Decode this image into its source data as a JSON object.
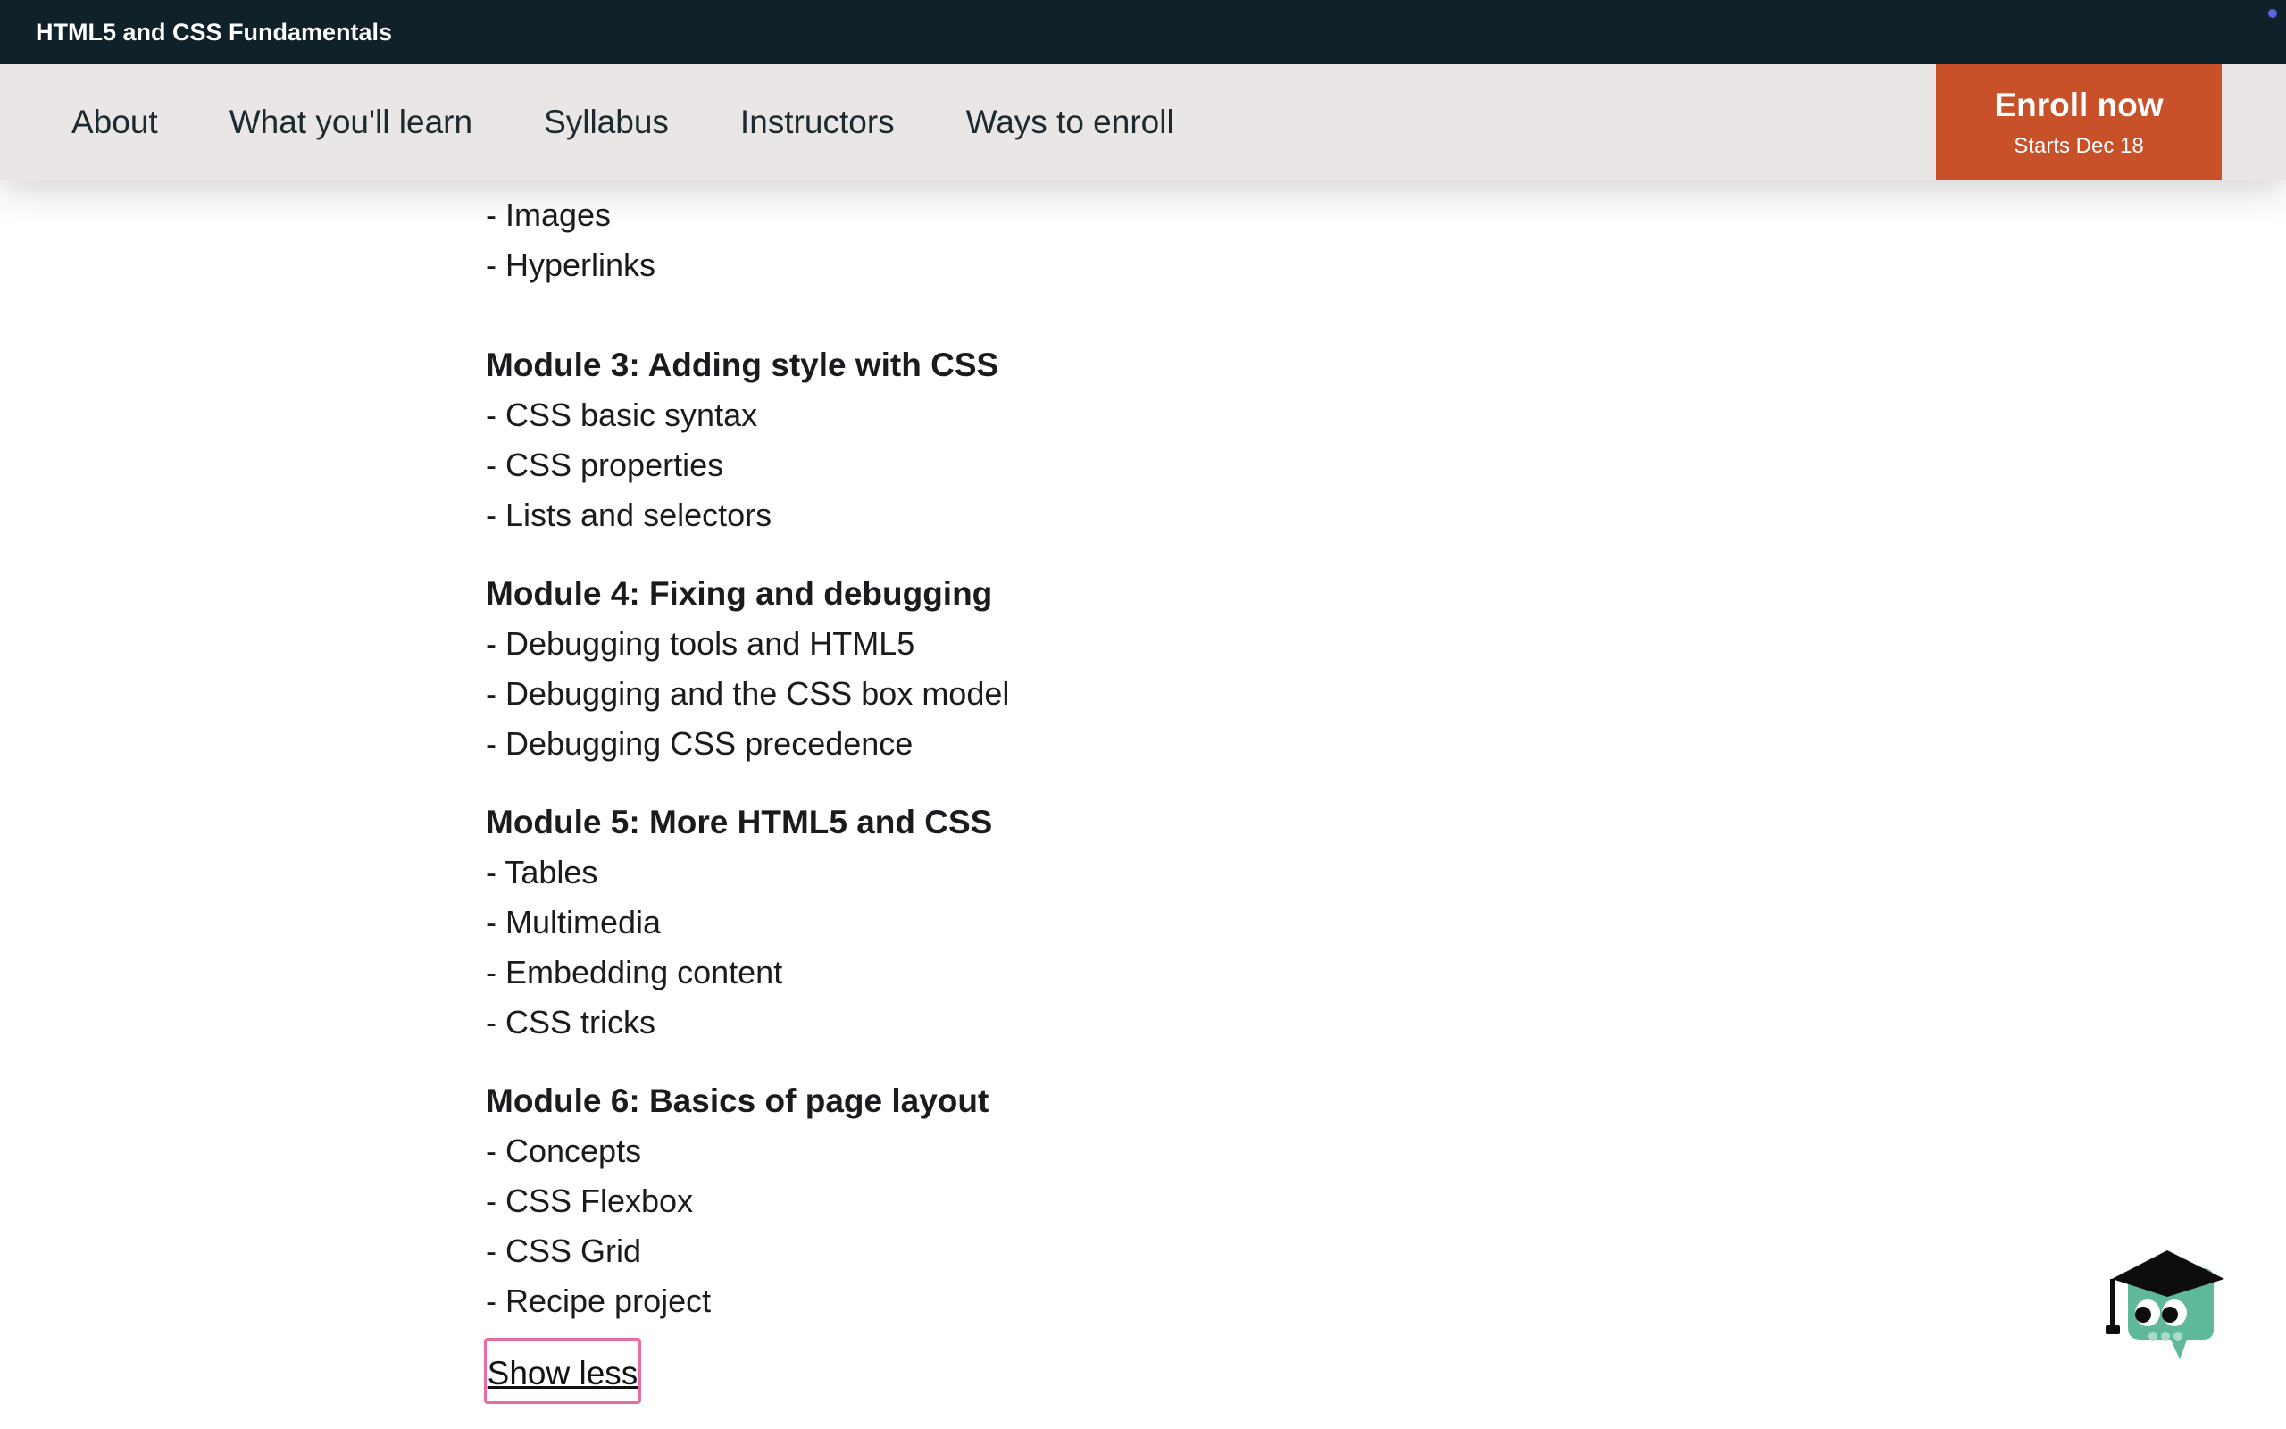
{
  "header": {
    "course_title": "HTML5 and CSS Fundamentals"
  },
  "nav": {
    "links": [
      "About",
      "What you'll learn",
      "Syllabus",
      "Instructors",
      "Ways to enroll"
    ],
    "enroll": {
      "label": "Enroll now",
      "sub": "Starts Dec 18"
    }
  },
  "syllabus": {
    "module2_tail": [
      "- Images",
      "- Hyperlinks"
    ],
    "module3": {
      "title": "Module 3: Adding style with CSS",
      "items": [
        "- CSS basic syntax",
        "- CSS properties",
        "- Lists and selectors"
      ]
    },
    "module4": {
      "title": "Module 4: Fixing and debugging",
      "items": [
        "- Debugging tools and HTML5",
        "- Debugging and the CSS box model",
        "- Debugging CSS precedence"
      ]
    },
    "module5": {
      "title": "Module 5: More HTML5 and CSS",
      "items": [
        "- Tables",
        "- Multimedia",
        "- Embedding content",
        "- CSS tricks"
      ]
    },
    "module6": {
      "title": "Module 6: Basics of page layout",
      "items": [
        "- Concepts",
        "- CSS Flexbox",
        "- CSS Grid",
        "- Recipe project"
      ]
    },
    "show_less": "Show less"
  },
  "colors": {
    "topbar": "#0f2229",
    "navbar": "#e9e6e5",
    "enroll": "#c8512a",
    "focus_outline": "#e46ca1",
    "mascot": "#5fb89a"
  },
  "icons": {
    "assistant": "graduation-cap-mascot-icon"
  }
}
